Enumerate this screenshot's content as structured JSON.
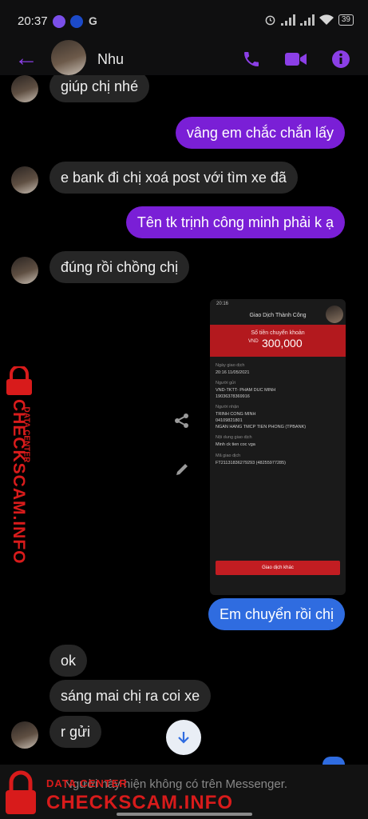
{
  "status": {
    "time": "20:37",
    "battery": "39"
  },
  "header": {
    "name": "Nhu"
  },
  "messages": {
    "m1": "giúp chị nhé",
    "m2": "vâng em chắc chắn lấy",
    "m3": "e bank đi chị xoá post với tìm xe đã",
    "m4": "Tên tk trịnh công minh phải k ạ",
    "m5": "đúng rồi chồng chị",
    "m6": "Em chuyển rồi chị",
    "m7": "ok",
    "m8": "sáng mai chị ra coi xe",
    "m9": "r gửi"
  },
  "receipt": {
    "status_time": "20:16",
    "title": "Giao Dịch Thành Công",
    "amount_label": "Số tiền chuyển khoản",
    "currency": "VND",
    "amount": "300,000",
    "date_label": "Ngày giao dịch",
    "date": "20:16 11/05/2021",
    "sender_label": "Người gửi",
    "sender_name": "VND-TKTT- PHAM DUC MINH",
    "sender_acct": "19036378369916",
    "receiver_label": "Người nhận",
    "receiver_name": "TRINH CONG MINH",
    "receiver_acct": "04109821801",
    "receiver_bank": "NGAN HANG TMCP TIEN PHONG (TPBANK)",
    "content_label": "Nội dung giao dịch",
    "content": "Minh ck tien coc vga",
    "code_label": "Mã giao dịch",
    "code": "FT21131836279293 (48255977285)",
    "button": "Giao dịch khác"
  },
  "watermark": {
    "top": "DATA CENTER",
    "main": "CHECKSCAM.INFO"
  },
  "bottom": {
    "notice": "Người này hiện không có trên Messenger."
  },
  "colors": {
    "purple": "#7a1fd6",
    "blue": "#2f6ce0",
    "incoming": "#262626",
    "watermark": "#d81b1b"
  }
}
